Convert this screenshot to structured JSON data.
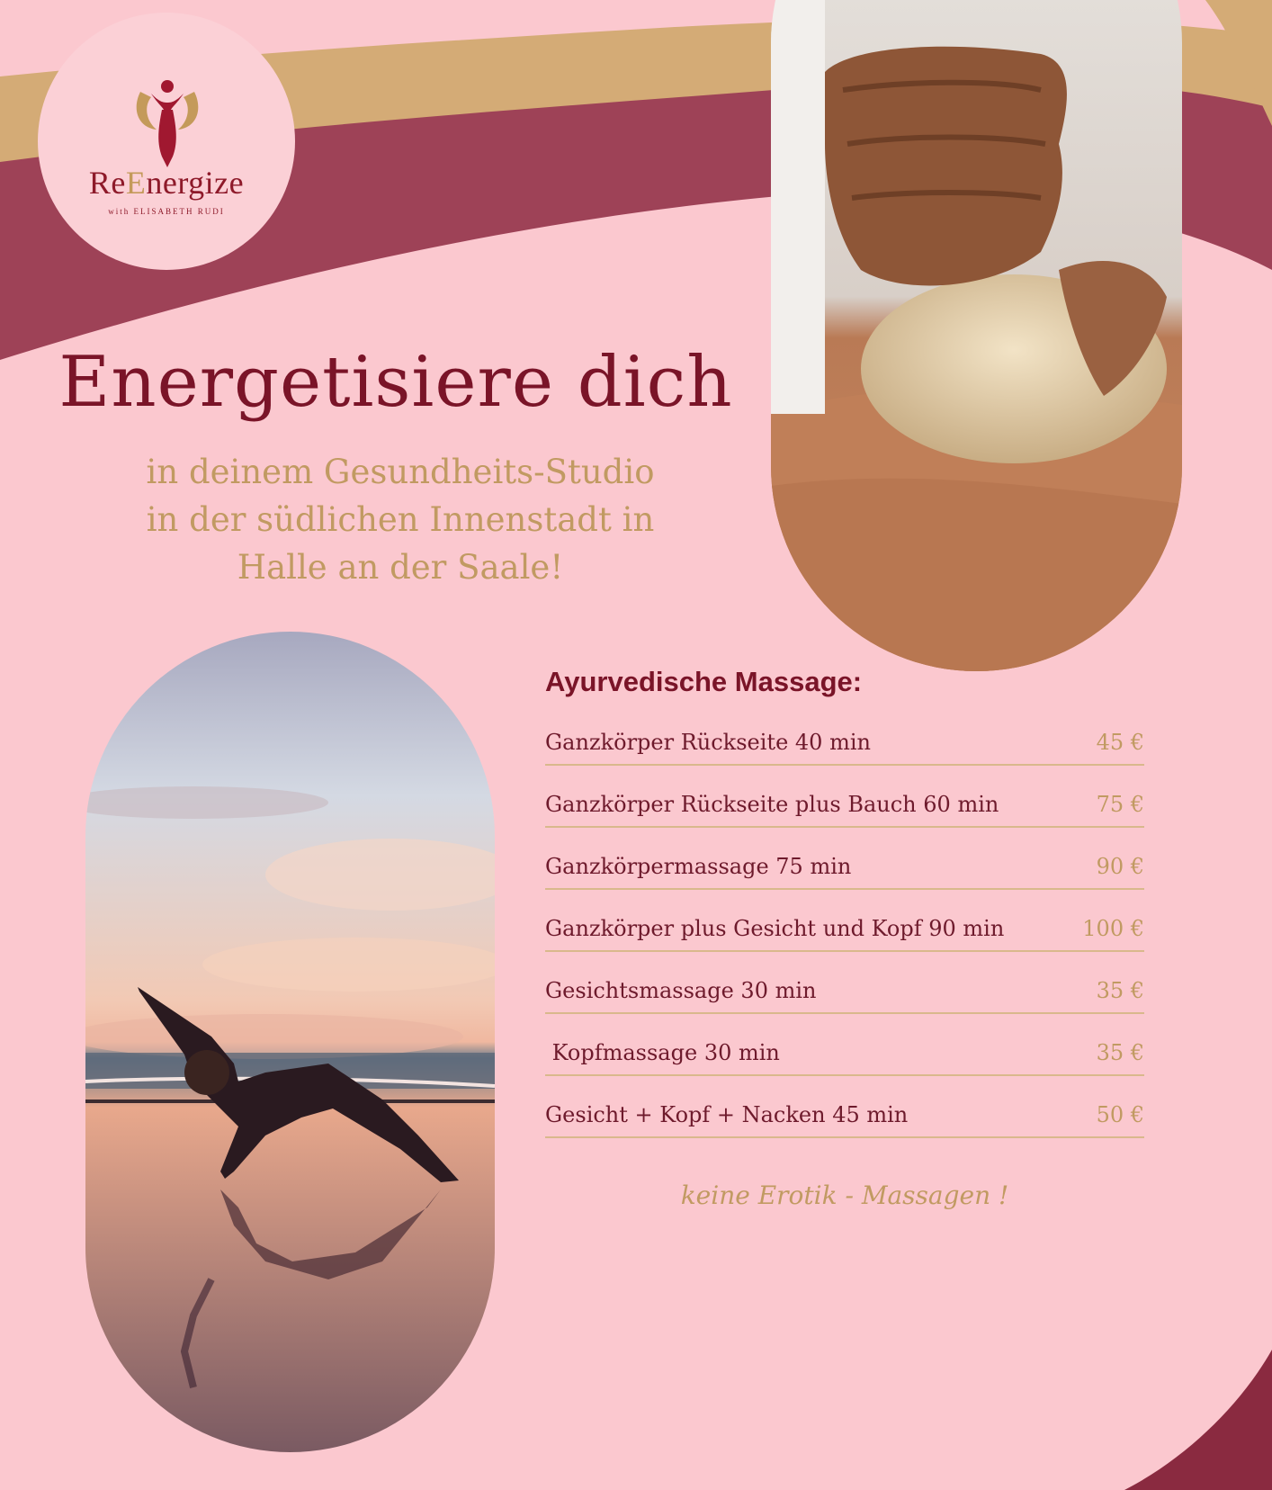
{
  "logo": {
    "name_part1": "Re",
    "name_part2": "E",
    "name_part3": "nergize",
    "tagline": "with ELISABETH RUDI"
  },
  "headline": "Energetisiere dich",
  "subline": [
    "in deinem Gesundheits-Studio",
    "in der südlichen Innenstadt in",
    "Halle an der Saale!"
  ],
  "menu": {
    "title": "Ayurvedische Massage:",
    "items": [
      {
        "name": "Ganzkörper Rückseite 40 min",
        "price": "45 €"
      },
      {
        "name": "Ganzkörper Rückseite plus Bauch 60 min",
        "price": "75 €"
      },
      {
        "name": "Ganzkörpermassage 75 min",
        "price": "90 €"
      },
      {
        "name": "Ganzkörper plus Gesicht und Kopf 90 min",
        "price": "100 €"
      },
      {
        "name": "Gesichtsmassage 30 min",
        "price": "35 €"
      },
      {
        "name": " Kopfmassage 30 min",
        "price": "35 €"
      },
      {
        "name": "Gesicht + Kopf + Nacken 45 min",
        "price": "50 €"
      }
    ]
  },
  "disclaimer": "keine Erotik - Massagen !",
  "colors": {
    "background": "#fbc8cf",
    "burgundy": "#7a1428",
    "gold": "#c19a62",
    "plum_wave": "#9e4257"
  }
}
